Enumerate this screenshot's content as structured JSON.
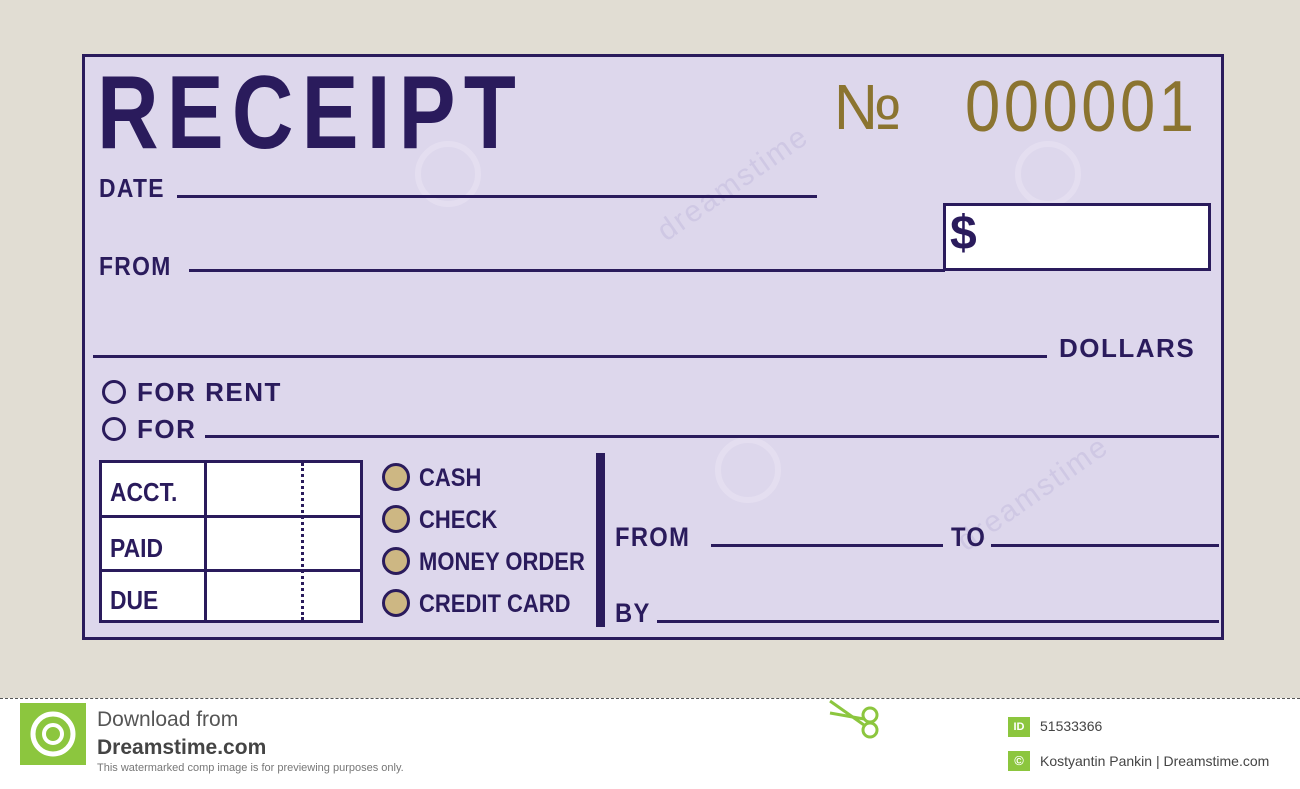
{
  "receipt": {
    "title": "RECEIPT",
    "number_symbol": "№",
    "number": "000001",
    "date_label": "DATE",
    "from_label": "FROM",
    "dollar_sign": "$",
    "dollars_label": "DOLLARS",
    "for_rent_label": "FOR RENT",
    "for_label": "FOR",
    "table_rows": [
      "ACCT.",
      "PAID",
      "DUE"
    ],
    "payment_methods": [
      "CASH",
      "CHECK",
      "MONEY ORDER",
      "CREDIT CARD"
    ],
    "period_from_label": "FROM",
    "period_to_label": "TO",
    "by_label": "BY"
  },
  "watermark": {
    "text": "dreamstime"
  },
  "footer": {
    "download_line1": "Download from",
    "download_line2": "Dreamstime.com",
    "disclaimer": "This watermarked comp image is for previewing purposes only.",
    "id_badge": "ID",
    "image_id": "51533366",
    "copyright_badge": "©",
    "credit": "Kostyantin Pankin | Dreamstime.com"
  },
  "colors": {
    "ink": "#2a1b5c",
    "paper": "#ddd7ec",
    "number_gold": "#8b7430",
    "coin_fill": "#cdb783",
    "brand_green": "#8cc63e",
    "background": "#e1ddd3"
  }
}
